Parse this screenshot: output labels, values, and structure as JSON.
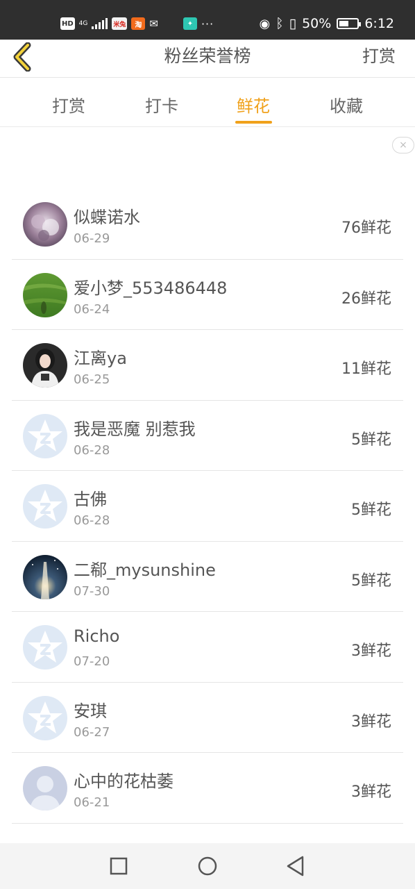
{
  "status_bar": {
    "left_badges": {
      "hd": "HD",
      "network": "4G",
      "app1": "米兔",
      "app2": "淘"
    },
    "more": "···",
    "battery": "50%",
    "time": "6:12"
  },
  "header": {
    "title": "粉丝荣誉榜",
    "action": "打赏"
  },
  "tabs": [
    {
      "label": "打赏"
    },
    {
      "label": "打卡"
    },
    {
      "label": "鲜花",
      "active": true
    },
    {
      "label": "收藏"
    }
  ],
  "ad_close": "×",
  "fans": [
    {
      "name": "似蝶诺水",
      "date": "06-29",
      "count": "76鲜花",
      "avatar": "photo-purple"
    },
    {
      "name": "爱小梦_553486448",
      "date": "06-24",
      "count": "26鲜花",
      "avatar": "photo-grass"
    },
    {
      "name": "江离ya",
      "date": "06-25",
      "count": "11鲜花",
      "avatar": "photo-girl"
    },
    {
      "name": "我是恶魔 别惹我",
      "date": "06-28",
      "count": "5鲜花",
      "avatar": "default-star"
    },
    {
      "name": "古佛",
      "date": "06-28",
      "count": "5鲜花",
      "avatar": "default-star"
    },
    {
      "name": "二郗_mysunshine",
      "date": "07-30",
      "count": "5鲜花",
      "avatar": "photo-night"
    },
    {
      "name": "Richo",
      "date": "07-20",
      "count": "3鲜花",
      "avatar": "default-star"
    },
    {
      "name": "安琪",
      "date": "06-27",
      "count": "3鲜花",
      "avatar": "default-star"
    },
    {
      "name": "心中的花枯萎",
      "date": "06-21",
      "count": "3鲜花",
      "avatar": "default-person"
    }
  ],
  "colors": {
    "accent": "#f0a11b",
    "status_bar": "#2f2f2f"
  }
}
